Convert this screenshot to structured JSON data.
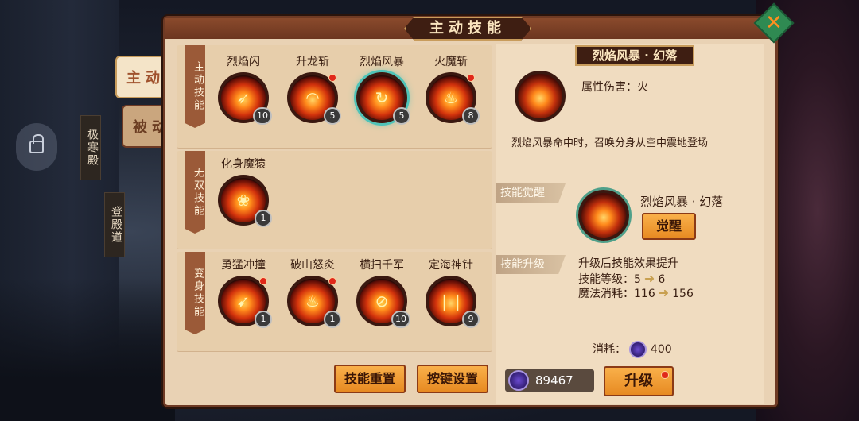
{
  "window": {
    "title": "主动技能",
    "close_icon": "close-icon"
  },
  "tabs": [
    {
      "label": "主动"
    },
    {
      "label": "被动"
    }
  ],
  "side_nav": [
    {
      "label": "极寒殿"
    },
    {
      "label": "登殿道"
    }
  ],
  "sections": {
    "active": {
      "label": "主动技能",
      "skills": [
        {
          "name": "烈焰闪",
          "level": "10"
        },
        {
          "name": "升龙斩",
          "level": "5"
        },
        {
          "name": "烈焰风暴",
          "level": "5"
        },
        {
          "name": "火魔斩",
          "level": "8"
        }
      ]
    },
    "ultimate": {
      "label": "无双技能",
      "skills": [
        {
          "name": "化身魔猿",
          "level": "1"
        }
      ]
    },
    "transform": {
      "label": "变身技能",
      "skills": [
        {
          "name": "勇猛冲撞",
          "level": "1"
        },
        {
          "name": "破山怒炎",
          "level": "1"
        },
        {
          "name": "横扫千军",
          "level": "10"
        },
        {
          "name": "定海神针",
          "level": "9"
        }
      ]
    }
  },
  "buttons": {
    "reset": "技能重置",
    "keybind": "按键设置",
    "awaken": "觉醒",
    "upgrade": "升级"
  },
  "detail": {
    "title": "烈焰风暴 · 幻落",
    "attr": "属性伤害：火",
    "desc": "烈焰风暴命中时，召唤分身从空中震地登场",
    "awaken_header": "技能觉醒",
    "awaken_name": "烈焰风暴 · 幻落",
    "upgrade_header": "技能升级",
    "upgrade_effect": "升级后技能效果提升",
    "level_label": "技能等级：",
    "level_from": "5",
    "level_to": "6",
    "mana_label": "魔法消耗：",
    "mana_from": "116",
    "mana_to": "156",
    "cost_label": "消耗：",
    "cost_value": "400",
    "currency": "89467"
  }
}
